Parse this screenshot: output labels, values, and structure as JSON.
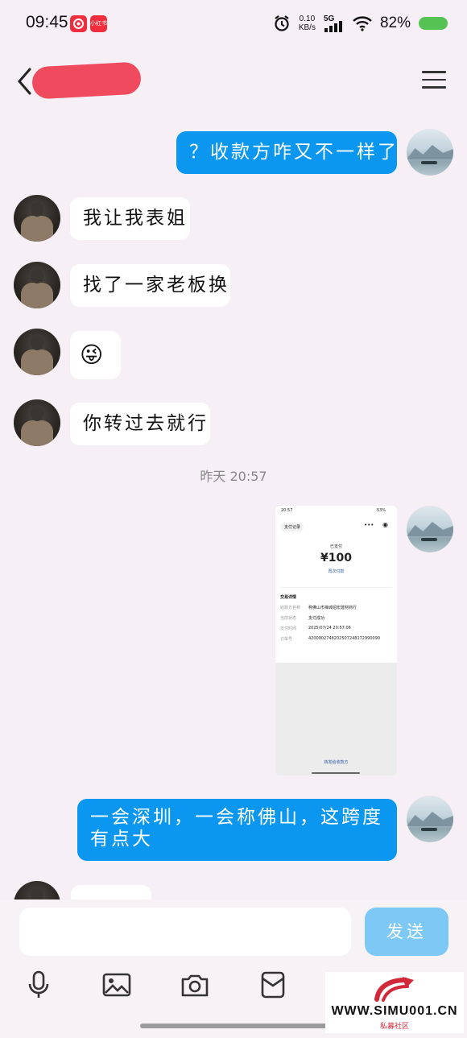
{
  "status_bar": {
    "time": "09:45",
    "app_icon_2_label": "小红书",
    "net_speed_value": "0.10",
    "net_speed_unit": "KB/s",
    "network": "5G",
    "battery": "82%"
  },
  "chat": {
    "messages": [
      {
        "from": "me",
        "text": "？收款方咋又不一样了"
      },
      {
        "from": "other",
        "text": "我让我表姐"
      },
      {
        "from": "other",
        "text": "找了一家老板换"
      },
      {
        "from": "other",
        "emoji": "😜"
      },
      {
        "from": "other",
        "text": "你转过去就行"
      }
    ],
    "timestamp": "昨天 20:57",
    "last_message": {
      "line1": "一会深圳，一会称佛山，这跨度",
      "line2": "有点大"
    }
  },
  "payment_screenshot": {
    "status_time": "20:57",
    "status_battery": "53%",
    "tab_label": "支付记录",
    "status": "已支付",
    "amount": "¥100",
    "pay_again": "再次付款",
    "section_title": "交易详情",
    "rows": [
      {
        "label": "收款方名称",
        "value": "称佛山市禅城绍宏建材商行"
      },
      {
        "label": "当前状态",
        "value": "支付成功"
      },
      {
        "label": "支付时间",
        "value": "2025/07/24 20:57:06"
      },
      {
        "label": "订单号",
        "value": "4200002748202507248172990090"
      }
    ],
    "footer_link": "转发给收款方"
  },
  "input": {
    "placeholder": "",
    "send_label": "发送"
  },
  "toolbar": {
    "icons": [
      "microphone-icon",
      "image-icon",
      "camera-icon",
      "wallet-icon"
    ]
  },
  "watermark": {
    "text": "WWW.SIMU001.CN",
    "sub": "私募社区"
  },
  "colors": {
    "outgoing_bubble": "#0b97f0",
    "incoming_bubble": "#ffffff",
    "send_button": "#7ec8f5",
    "background": "#f6eff5"
  }
}
